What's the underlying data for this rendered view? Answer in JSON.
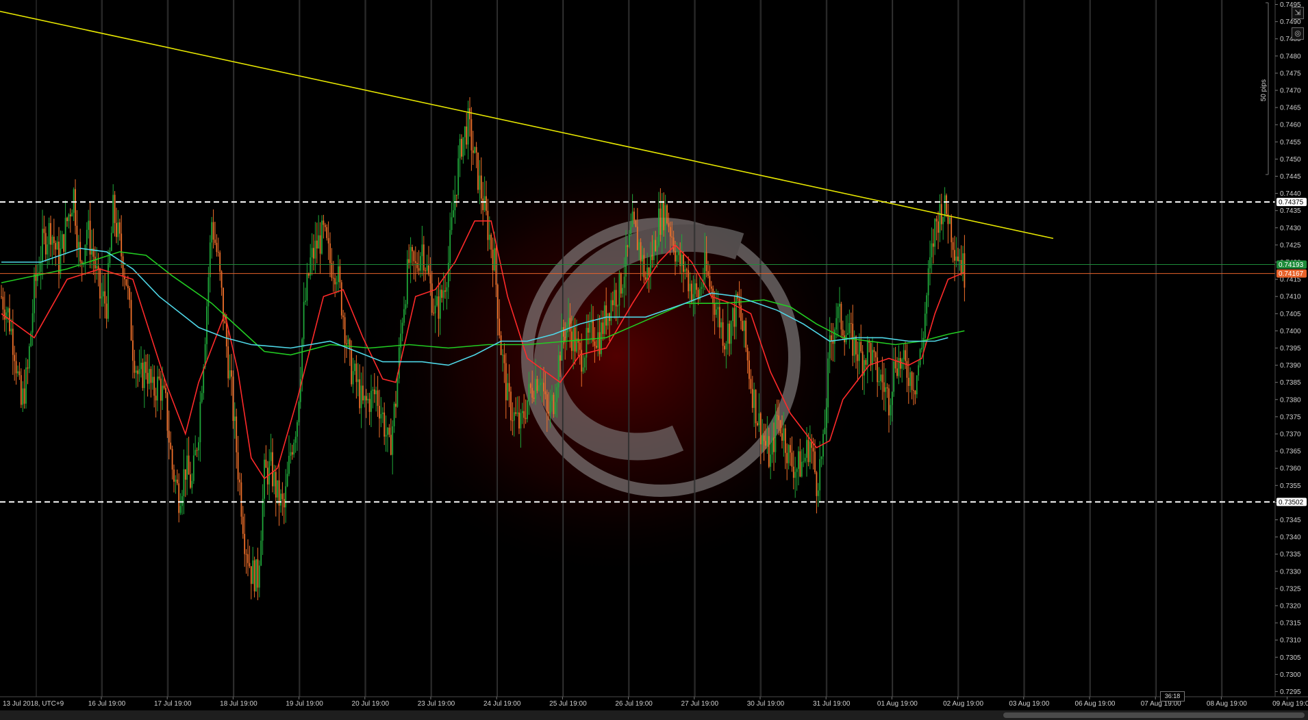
{
  "chart_data": {
    "type": "candlestick",
    "timezone_label": "13 Jul 2018, UTC+9",
    "x_tick_labels": [
      "16 Jul 19:00",
      "17 Jul 19:00",
      "18 Jul 19:00",
      "19 Jul 19:00",
      "20 Jul 19:00",
      "23 Jul 19:00",
      "24 Jul 19:00",
      "25 Jul 19:00",
      "26 Jul 19:00",
      "27 Jul 19:00",
      "30 Jul 19:00",
      "31 Jul 19:00",
      "01 Aug 19:00",
      "02 Aug 19:00",
      "03 Aug 19:00",
      "06 Aug 19:00",
      "07 Aug 19:00",
      "08 Aug 19:00",
      "09 Aug 19:00"
    ],
    "y_ticks": [
      0.7295,
      0.73,
      0.7305,
      0.731,
      0.7315,
      0.732,
      0.7325,
      0.733,
      0.7335,
      0.734,
      0.7345,
      0.735,
      0.7355,
      0.736,
      0.7365,
      0.737,
      0.7375,
      0.738,
      0.7385,
      0.739,
      0.7395,
      0.74,
      0.7405,
      0.741,
      0.7415,
      0.742,
      0.7425,
      0.743,
      0.7435,
      0.744,
      0.7445,
      0.745,
      0.7455,
      0.746,
      0.7465,
      0.747,
      0.7475,
      0.748,
      0.7485,
      0.749,
      0.7495
    ],
    "ylim": [
      0.72935,
      0.74963
    ],
    "y_tick_decimals": 4,
    "horizontal_levels": [
      {
        "value": 0.74375,
        "label": "0.74375",
        "style": "dashed",
        "color": "#ffffff"
      },
      {
        "value": 0.73502,
        "label": "0.73502",
        "style": "dashed",
        "color": "#ffffff"
      }
    ],
    "price_tags": [
      {
        "value": 0.74193,
        "label": "0.74193",
        "color": "#1e8c3a"
      },
      {
        "value": 0.74167,
        "label": "0.74167",
        "color": "#e8622a"
      }
    ],
    "trendline": {
      "color": "#e6e600",
      "start": {
        "index": -30,
        "value": 0.7496
      },
      "end": {
        "index": 640,
        "value": 0.74269
      }
    },
    "price_path": [
      [
        0,
        0.741
      ],
      [
        4,
        0.7405
      ],
      [
        8,
        0.7395
      ],
      [
        12,
        0.7378
      ],
      [
        16,
        0.7388
      ],
      [
        20,
        0.7412
      ],
      [
        25,
        0.7425
      ],
      [
        30,
        0.743
      ],
      [
        35,
        0.742
      ],
      [
        40,
        0.7432
      ],
      [
        44,
        0.744
      ],
      [
        48,
        0.7418
      ],
      [
        52,
        0.743
      ],
      [
        56,
        0.7422
      ],
      [
        60,
        0.741
      ],
      [
        64,
        0.7408
      ],
      [
        68,
        0.7435
      ],
      [
        72,
        0.7425
      ],
      [
        76,
        0.7415
      ],
      [
        80,
        0.7395
      ],
      [
        84,
        0.7385
      ],
      [
        88,
        0.739
      ],
      [
        92,
        0.7382
      ],
      [
        96,
        0.7385
      ],
      [
        100,
        0.7378
      ],
      [
        104,
        0.736
      ],
      [
        108,
        0.7352
      ],
      [
        112,
        0.736
      ],
      [
        116,
        0.7355
      ],
      [
        120,
        0.7372
      ],
      [
        124,
        0.74
      ],
      [
        128,
        0.7432
      ],
      [
        132,
        0.742
      ],
      [
        136,
        0.74
      ],
      [
        140,
        0.7382
      ],
      [
        144,
        0.736
      ],
      [
        148,
        0.734
      ],
      [
        152,
        0.733
      ],
      [
        156,
        0.7328
      ],
      [
        160,
        0.7358
      ],
      [
        164,
        0.736
      ],
      [
        168,
        0.7352
      ],
      [
        172,
        0.7348
      ],
      [
        176,
        0.7365
      ],
      [
        180,
        0.7375
      ],
      [
        184,
        0.7405
      ],
      [
        188,
        0.742
      ],
      [
        192,
        0.7425
      ],
      [
        196,
        0.7428
      ],
      [
        200,
        0.742
      ],
      [
        204,
        0.7418
      ],
      [
        208,
        0.7405
      ],
      [
        212,
        0.739
      ],
      [
        216,
        0.7385
      ],
      [
        220,
        0.7378
      ],
      [
        224,
        0.738
      ],
      [
        228,
        0.7382
      ],
      [
        232,
        0.7375
      ],
      [
        236,
        0.7365
      ],
      [
        240,
        0.738
      ],
      [
        244,
        0.7405
      ],
      [
        248,
        0.742
      ],
      [
        252,
        0.7418
      ],
      [
        256,
        0.7425
      ],
      [
        260,
        0.7415
      ],
      [
        264,
        0.7405
      ],
      [
        268,
        0.741
      ],
      [
        272,
        0.742
      ],
      [
        276,
        0.744
      ],
      [
        280,
        0.7455
      ],
      [
        284,
        0.746
      ],
      [
        288,
        0.745
      ],
      [
        292,
        0.744
      ],
      [
        296,
        0.743
      ],
      [
        300,
        0.742
      ],
      [
        304,
        0.7395
      ],
      [
        308,
        0.738
      ],
      [
        312,
        0.7375
      ],
      [
        316,
        0.7372
      ],
      [
        320,
        0.738
      ],
      [
        324,
        0.7385
      ],
      [
        328,
        0.7388
      ],
      [
        332,
        0.7375
      ],
      [
        336,
        0.738
      ],
      [
        340,
        0.7395
      ],
      [
        344,
        0.7402
      ],
      [
        348,
        0.7398
      ],
      [
        352,
        0.7392
      ],
      [
        356,
        0.7396
      ],
      [
        360,
        0.74
      ],
      [
        364,
        0.7398
      ],
      [
        368,
        0.7405
      ],
      [
        372,
        0.741
      ],
      [
        376,
        0.7412
      ],
      [
        380,
        0.742
      ],
      [
        384,
        0.743
      ],
      [
        388,
        0.7425
      ],
      [
        392,
        0.7415
      ],
      [
        396,
        0.7422
      ],
      [
        400,
        0.7432
      ],
      [
        404,
        0.7435
      ],
      [
        408,
        0.7428
      ],
      [
        412,
        0.742
      ],
      [
        416,
        0.7418
      ],
      [
        420,
        0.7412
      ],
      [
        424,
        0.741
      ],
      [
        428,
        0.7418
      ],
      [
        432,
        0.7412
      ],
      [
        436,
        0.7405
      ],
      [
        440,
        0.7398
      ],
      [
        444,
        0.7402
      ],
      [
        448,
        0.7408
      ],
      [
        452,
        0.7398
      ],
      [
        456,
        0.7385
      ],
      [
        460,
        0.7375
      ],
      [
        464,
        0.7368
      ],
      [
        468,
        0.7362
      ],
      [
        472,
        0.7375
      ],
      [
        476,
        0.737
      ],
      [
        480,
        0.7362
      ],
      [
        484,
        0.736
      ],
      [
        488,
        0.7362
      ],
      [
        492,
        0.7368
      ],
      [
        496,
        0.7356
      ],
      [
        500,
        0.7365
      ],
      [
        504,
        0.7395
      ],
      [
        508,
        0.7405
      ],
      [
        512,
        0.7402
      ],
      [
        516,
        0.7398
      ],
      [
        520,
        0.7395
      ],
      [
        524,
        0.7392
      ],
      [
        528,
        0.7395
      ],
      [
        532,
        0.7388
      ],
      [
        536,
        0.7385
      ],
      [
        540,
        0.738
      ],
      [
        544,
        0.7392
      ],
      [
        548,
        0.739
      ],
      [
        552,
        0.7388
      ],
      [
        556,
        0.7385
      ],
      [
        560,
        0.7395
      ],
      [
        564,
        0.7415
      ],
      [
        568,
        0.743
      ],
      [
        572,
        0.7436
      ],
      [
        576,
        0.7434
      ],
      [
        580,
        0.7425
      ],
      [
        584,
        0.742
      ],
      [
        586,
        0.7417
      ]
    ],
    "moving_averages": [
      {
        "color": "#ff2a2a",
        "points": [
          [
            0,
            0.7405
          ],
          [
            20,
            0.7398
          ],
          [
            40,
            0.7415
          ],
          [
            60,
            0.7418
          ],
          [
            80,
            0.7415
          ],
          [
            100,
            0.7385
          ],
          [
            112,
            0.737
          ],
          [
            120,
            0.7385
          ],
          [
            136,
            0.7405
          ],
          [
            144,
            0.7388
          ],
          [
            152,
            0.7363
          ],
          [
            160,
            0.7357
          ],
          [
            168,
            0.736
          ],
          [
            180,
            0.738
          ],
          [
            196,
            0.741
          ],
          [
            208,
            0.7412
          ],
          [
            220,
            0.7398
          ],
          [
            232,
            0.7386
          ],
          [
            240,
            0.7385
          ],
          [
            252,
            0.741
          ],
          [
            264,
            0.7412
          ],
          [
            276,
            0.742
          ],
          [
            288,
            0.7432
          ],
          [
            298,
            0.7432
          ],
          [
            308,
            0.741
          ],
          [
            320,
            0.7392
          ],
          [
            340,
            0.7385
          ],
          [
            352,
            0.7393
          ],
          [
            368,
            0.7395
          ],
          [
            384,
            0.7408
          ],
          [
            400,
            0.742
          ],
          [
            410,
            0.7425
          ],
          [
            420,
            0.742
          ],
          [
            432,
            0.741
          ],
          [
            444,
            0.7408
          ],
          [
            456,
            0.7405
          ],
          [
            468,
            0.7388
          ],
          [
            480,
            0.7376
          ],
          [
            496,
            0.7366
          ],
          [
            504,
            0.7368
          ],
          [
            512,
            0.738
          ],
          [
            528,
            0.739
          ],
          [
            540,
            0.7392
          ],
          [
            552,
            0.739
          ],
          [
            560,
            0.7392
          ],
          [
            568,
            0.7405
          ],
          [
            576,
            0.7415
          ],
          [
            586,
            0.7417
          ]
        ]
      },
      {
        "color": "#22cc22",
        "points": [
          [
            0,
            0.7414
          ],
          [
            40,
            0.7418
          ],
          [
            72,
            0.7423
          ],
          [
            88,
            0.7422
          ],
          [
            104,
            0.7416
          ],
          [
            128,
            0.7408
          ],
          [
            144,
            0.7401
          ],
          [
            160,
            0.7394
          ],
          [
            176,
            0.7393
          ],
          [
            200,
            0.7396
          ],
          [
            224,
            0.7395
          ],
          [
            248,
            0.7396
          ],
          [
            272,
            0.7395
          ],
          [
            296,
            0.7396
          ],
          [
            320,
            0.7396
          ],
          [
            344,
            0.7397
          ],
          [
            368,
            0.7398
          ],
          [
            392,
            0.7403
          ],
          [
            416,
            0.7408
          ],
          [
            440,
            0.7408
          ],
          [
            464,
            0.7409
          ],
          [
            480,
            0.7407
          ],
          [
            496,
            0.7402
          ],
          [
            512,
            0.7398
          ],
          [
            528,
            0.7397
          ],
          [
            544,
            0.7396
          ],
          [
            560,
            0.7397
          ],
          [
            576,
            0.7399
          ],
          [
            586,
            0.74
          ]
        ]
      },
      {
        "color": "#4fd8e8",
        "points": [
          [
            0,
            0.742
          ],
          [
            24,
            0.742
          ],
          [
            48,
            0.7424
          ],
          [
            64,
            0.7423
          ],
          [
            80,
            0.7418
          ],
          [
            96,
            0.741
          ],
          [
            112,
            0.7404
          ],
          [
            120,
            0.7401
          ],
          [
            136,
            0.7398
          ],
          [
            152,
            0.7396
          ],
          [
            176,
            0.7395
          ],
          [
            200,
            0.7397
          ],
          [
            216,
            0.7394
          ],
          [
            232,
            0.7391
          ],
          [
            256,
            0.7391
          ],
          [
            272,
            0.739
          ],
          [
            288,
            0.7393
          ],
          [
            304,
            0.7397
          ],
          [
            320,
            0.7397
          ],
          [
            336,
            0.7399
          ],
          [
            352,
            0.7402
          ],
          [
            368,
            0.7404
          ],
          [
            392,
            0.7404
          ],
          [
            416,
            0.7408
          ],
          [
            432,
            0.7411
          ],
          [
            448,
            0.741
          ],
          [
            472,
            0.7406
          ],
          [
            488,
            0.7402
          ],
          [
            504,
            0.7397
          ],
          [
            520,
            0.7398
          ],
          [
            536,
            0.7398
          ],
          [
            552,
            0.7397
          ],
          [
            568,
            0.7397
          ],
          [
            576,
            0.7398
          ]
        ]
      }
    ]
  },
  "ui": {
    "pips_label": "50 pips",
    "timer": "36:18",
    "maximize_icon": "maximize-icon",
    "camera_icon": "camera-icon"
  }
}
